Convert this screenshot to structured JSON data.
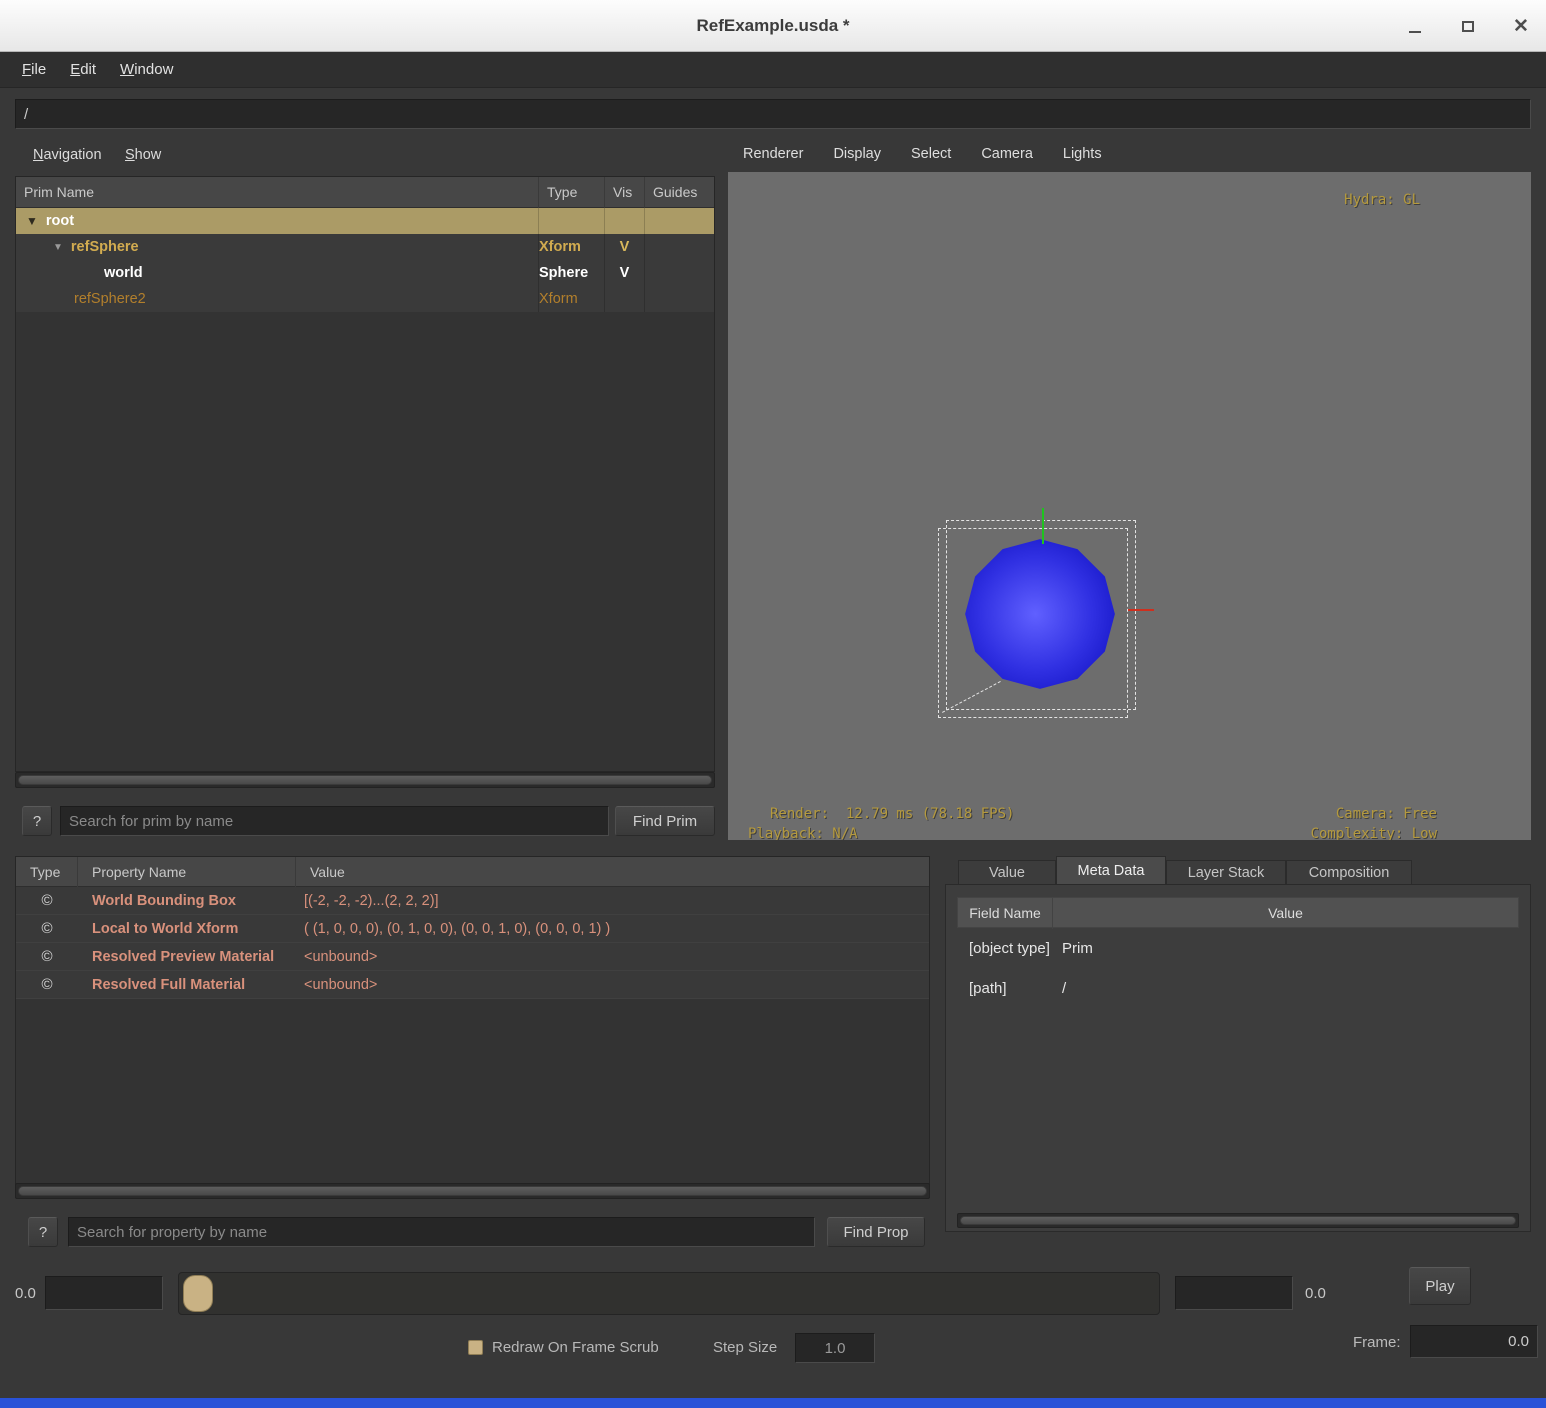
{
  "window": {
    "title": "RefExample.usda *",
    "controls": {
      "close": "✕"
    }
  },
  "menubar": {
    "items": [
      "File",
      "Edit",
      "Window"
    ]
  },
  "pathbar": {
    "value": "/"
  },
  "prim_panel": {
    "tabs": [
      "Navigation",
      "Show"
    ],
    "columns": [
      "Prim Name",
      "Type",
      "Vis",
      "Guides"
    ],
    "expand_icon": "▼",
    "rows": [
      {
        "name": "root",
        "type": "",
        "vis": "",
        "selected": true
      },
      {
        "name": "refSphere",
        "type": "Xform",
        "vis": "V"
      },
      {
        "name": "world",
        "type": "Sphere",
        "vis": "V"
      },
      {
        "name": "refSphere2",
        "type": "Xform",
        "vis": ""
      }
    ],
    "search": {
      "help": "?",
      "placeholder": "Search for prim by name",
      "button": "Find Prim"
    }
  },
  "viewport": {
    "menu": [
      "Renderer",
      "Display",
      "Select",
      "Camera",
      "Lights"
    ],
    "hud": {
      "renderer": "Hydra: GL",
      "render_stats": "Render:  12.79 ms (78.18 FPS)",
      "playback": "Playback: N/A",
      "camera": "Camera: Free",
      "complexity": "Complexity: Low"
    }
  },
  "property_panel": {
    "columns": [
      "Type",
      "Property Name",
      "Value"
    ],
    "computed_icon": "©",
    "rows": [
      {
        "name": "World Bounding Box",
        "value": "[(-2, -2, -2)...(2, 2, 2)]"
      },
      {
        "name": "Local to World Xform",
        "value": "( (1, 0, 0, 0), (0, 1, 0, 0), (0, 0, 1, 0), (0, 0, 0, 1) )"
      },
      {
        "name": "Resolved Preview Material",
        "value": "<unbound>"
      },
      {
        "name": "Resolved Full Material",
        "value": "<unbound>"
      }
    ],
    "search": {
      "help": "?",
      "placeholder": "Search for property by name",
      "button": "Find Prop"
    }
  },
  "meta_panel": {
    "tabs": [
      "Value",
      "Meta Data",
      "Layer Stack",
      "Composition"
    ],
    "active_tab": "Meta Data",
    "columns": [
      "Field Name",
      "Value"
    ],
    "rows": [
      {
        "field": "[object type]",
        "value": "Prim"
      },
      {
        "field": "[path]",
        "value": "/"
      }
    ]
  },
  "timeline": {
    "start_label": "0.0",
    "start_input": "",
    "end_input": "",
    "end_label": "0.0",
    "play_button": "Play",
    "redraw_label": "Redraw On Frame Scrub",
    "step_size_label": "Step Size",
    "step_size_value": "1.0",
    "frame_label": "Frame:",
    "frame_value": "0.0"
  },
  "colors": {
    "selection_tan": "#ab9b66",
    "prim_reference_gold": "#d2ac50",
    "prim_inactive_orange": "#b27f2c",
    "property_salmon": "#d9917c",
    "hud_tan": "#b59a3e",
    "sphere_blue": "#2222dd",
    "bottom_strip_blue": "#2952d8"
  }
}
